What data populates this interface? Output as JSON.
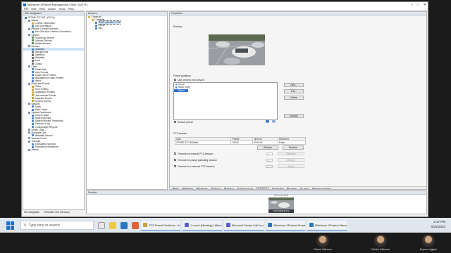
{
  "window": {
    "title": "Milestone XProtect Management Client 2020 R2",
    "menu": [
      "File",
      "Edit",
      "View",
      "Action",
      "Tools",
      "Help"
    ]
  },
  "site_navigation": {
    "header": "Site Navigation",
    "items": [
      {
        "label": "STONE-S27-WS - (20.2a)",
        "level": 0,
        "color": "#3a6fb0"
      },
      {
        "label": "Basics",
        "level": 1,
        "color": "#7d8fa6"
      },
      {
        "label": "License Information",
        "level": 2,
        "color": "#c7a23a"
      },
      {
        "label": "Site Information",
        "level": 2,
        "color": "#4f86c6"
      },
      {
        "label": "Remote Connect Services",
        "level": 1,
        "color": "#7d8fa6"
      },
      {
        "label": "Axis One-click Camera Connection",
        "level": 2,
        "color": "#4f86c6"
      },
      {
        "label": "Servers",
        "level": 1,
        "color": "#7d8fa6"
      },
      {
        "label": "Recording Servers",
        "level": 2,
        "color": "#5b8a5b"
      },
      {
        "label": "Failover Servers",
        "level": 2,
        "color": "#5b8a5b"
      },
      {
        "label": "Mobile Servers",
        "level": 2,
        "color": "#5b8a5b"
      },
      {
        "label": "Devices",
        "level": 1,
        "color": "#7d8fa6"
      },
      {
        "label": "Cameras",
        "level": 2,
        "color": "#4f86c6",
        "selected": true
      },
      {
        "label": "Microphones",
        "level": 2,
        "color": "#6b6b6b"
      },
      {
        "label": "Speakers",
        "level": 2,
        "color": "#6b6b6b"
      },
      {
        "label": "Metadata",
        "level": 2,
        "color": "#6b6b6b"
      },
      {
        "label": "Input",
        "level": 2,
        "color": "#6b6b6b"
      },
      {
        "label": "Output",
        "level": 2,
        "color": "#6b6b6b"
      },
      {
        "label": "Client",
        "level": 1,
        "color": "#7d8fa6"
      },
      {
        "label": "Smart Wall",
        "level": 2,
        "color": "#4f86c6"
      },
      {
        "label": "View Groups",
        "level": 2,
        "color": "#4f86c6"
      },
      {
        "label": "Smart Client Profiles",
        "level": 2,
        "color": "#4f86c6"
      },
      {
        "label": "Management Client Profiles",
        "level": 2,
        "color": "#4f86c6"
      },
      {
        "label": "Matrix",
        "level": 2,
        "color": "#4f86c6"
      },
      {
        "label": "Rules and Events",
        "level": 1,
        "color": "#7d8fa6"
      },
      {
        "label": "Rules",
        "level": 2,
        "color": "#c7a23a"
      },
      {
        "label": "Time Profiles",
        "level": 2,
        "color": "#c7a23a"
      },
      {
        "label": "Notification Profiles",
        "level": 2,
        "color": "#c7a23a"
      },
      {
        "label": "User-defined Events",
        "level": 2,
        "color": "#c7a23a"
      },
      {
        "label": "Analytics Events",
        "level": 2,
        "color": "#c7a23a"
      },
      {
        "label": "Generic Events",
        "level": 2,
        "color": "#c7a23a"
      },
      {
        "label": "Security",
        "level": 1,
        "color": "#7d8fa6"
      },
      {
        "label": "Roles",
        "level": 2,
        "color": "#4f86c6"
      },
      {
        "label": "Basic Users",
        "level": 2,
        "color": "#4f86c6"
      },
      {
        "label": "System Dashboard",
        "level": 1,
        "color": "#7d8fa6"
      },
      {
        "label": "Current Tasks",
        "level": 2,
        "color": "#4f86c6"
      },
      {
        "label": "System Monitor",
        "level": 2,
        "color": "#4f86c6"
      },
      {
        "label": "System Monitor Thresholds",
        "level": 2,
        "color": "#4f86c6"
      },
      {
        "label": "Evidence Lock",
        "level": 2,
        "color": "#4f86c6"
      },
      {
        "label": "Configuration Reports",
        "level": 2,
        "color": "#4f86c6"
      },
      {
        "label": "Server Logs",
        "level": 1,
        "color": "#7d8fa6"
      },
      {
        "label": "Metadata Use",
        "level": 1,
        "color": "#7d8fa6"
      },
      {
        "label": "Metadata Search",
        "level": 2,
        "color": "#4f86c6"
      },
      {
        "label": "Access Control",
        "level": 1,
        "color": "#7d8fa6"
      },
      {
        "label": "Transact",
        "level": 1,
        "color": "#7d8fa6"
      },
      {
        "label": "Transaction sources",
        "level": 2,
        "color": "#4f86c6"
      },
      {
        "label": "Transaction definitions",
        "level": 2,
        "color": "#4f86c6"
      },
      {
        "label": "Alarms",
        "level": 1,
        "color": "#7d8fa6"
      }
    ],
    "tabs": [
      "Site Navigation",
      "Federated Site Hierarchy"
    ]
  },
  "device_tree": {
    "header": "Devices",
    "items": [
      {
        "label": "Cameras",
        "level": 0
      },
      {
        "label": "Cameras",
        "level": 1
      },
      {
        "label": "AXIS Q6155-E PTZ",
        "level": 2,
        "selected": true
      },
      {
        "label": "Drove",
        "level": 2
      },
      {
        "label": "Sky",
        "level": 2
      }
    ]
  },
  "properties": {
    "header": "Properties",
    "preview_label": "Preview",
    "preset_positions_label": "Preset positions",
    "use_presets_label": "Use presets from device",
    "presets": [
      {
        "label": "Home",
        "selected": false
      },
      {
        "label": "North Entry",
        "selected": false
      },
      {
        "label": "Street View",
        "selected": true
      }
    ],
    "preset_buttons": [
      "New...",
      "Edit...",
      "Delete"
    ],
    "activate_button": "Activate",
    "default_preset_label": "Default preset",
    "ptz_session_label": "PTZ session",
    "session_columns": [
      "User",
      "Priority",
      "Timeout",
      "Reserved"
    ],
    "session_row": [
      "STONE-S27-WS\\ketis",
      "32000",
      "00:00:00",
      "False"
    ],
    "release_button": "Release",
    "reserve_button": "Reserve",
    "timeouts": [
      {
        "label": "Timeout for manual PTZ session",
        "value": "15",
        "unit": "Seconds"
      },
      {
        "label": "Timeout for pause patrolling session",
        "value": "10",
        "unit": "Minutes"
      },
      {
        "label": "Timeout for reserved PTZ session",
        "value": "1",
        "unit": "Hours"
      }
    ],
    "tabs": [
      "Info",
      "Settings",
      "Streams",
      "Record",
      "Motion",
      "Fisheye Lens",
      "Presets",
      "Patrolling",
      "Events",
      "Client",
      "Privacy masking"
    ],
    "active_tab": "Presets"
  },
  "preview_pane": {
    "header": "Preview",
    "thumb_caption": "2020-07-02 10:05",
    "thumb_label": "AXIS Q6155-E PTZ"
  },
  "taskbar": {
    "search_placeholder": "Type here to search",
    "tasks": [
      {
        "label": "PTZ Preset Positions - AXIS...",
        "color": "#c7a23a"
      },
      {
        "label": "1 more! (Meeting) | Microsoft...",
        "color": "#5b5fc7"
      },
      {
        "label": "Microsoft Teams Call in pro...",
        "color": "#5b5fc7"
      },
      {
        "label": "Milestone XProtect Smart ...",
        "color": "#2a78c2"
      },
      {
        "label": "Milestone XProtect Manag...",
        "color": "#2a78c2"
      }
    ],
    "time": "2:17 PM",
    "date": "6/22/2020"
  },
  "participants": [
    "Patrick Kittinson",
    "Patrick Kittinson",
    "Bryson Higgins"
  ]
}
